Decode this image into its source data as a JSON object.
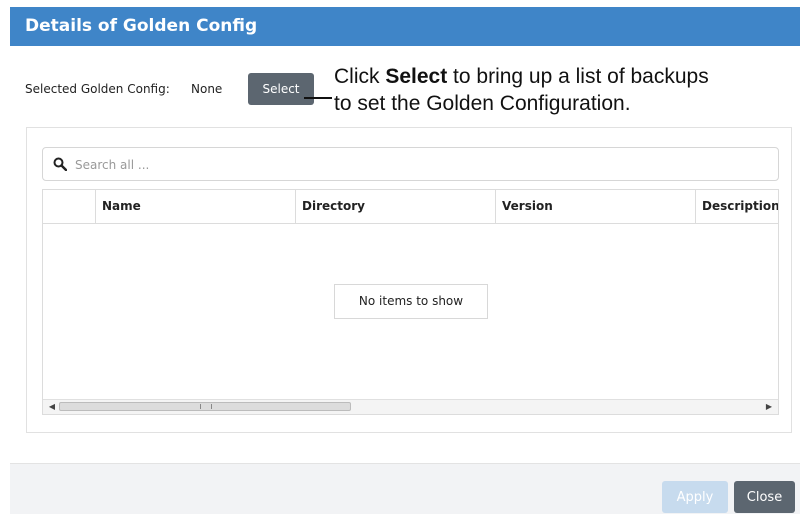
{
  "dialog": {
    "title": "Details of Golden Config"
  },
  "golden_config": {
    "label": "Selected Golden Config:",
    "value": "None",
    "select_label": "Select"
  },
  "callout": {
    "prefix": "Click ",
    "bold": "Select",
    "line1_rest": " to bring up a list of backups",
    "line2": "to set the Golden Configuration."
  },
  "search": {
    "placeholder": "Search all ...",
    "icon": "search-icon"
  },
  "table": {
    "columns": [
      "Name",
      "Directory",
      "Version",
      "Description"
    ],
    "empty_message": "No items to show"
  },
  "footer": {
    "apply_label": "Apply",
    "close_label": "Close"
  },
  "colors": {
    "title_bar": "#3f85c8",
    "button_dark": "#5c6670",
    "button_disabled": "#c7dbee"
  }
}
